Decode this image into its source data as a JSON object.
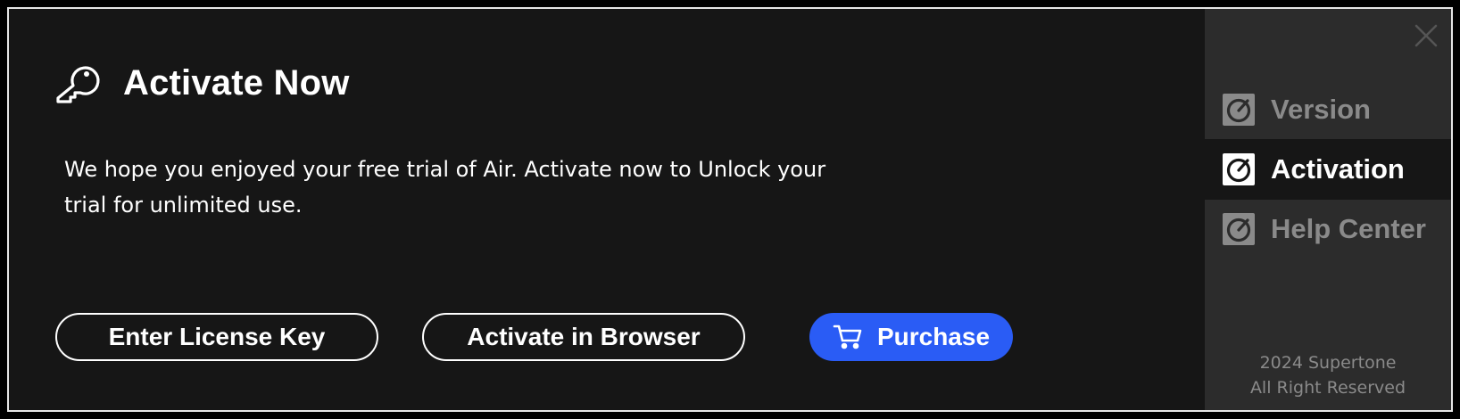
{
  "dialog": {
    "title": "Activate Now",
    "description": "We hope you enjoyed your free trial of Air. Activate now to Unlock your trial for unlimited use.",
    "buttons": {
      "license_label": "Enter License Key",
      "browser_label": "Activate in Browser",
      "purchase_label": "Purchase"
    },
    "icons": {
      "title": "key-icon",
      "purchase": "cart-icon"
    }
  },
  "sidebar": {
    "items": [
      {
        "label": "Version",
        "icon": "dial-icon",
        "active": false
      },
      {
        "label": "Activation",
        "icon": "dial-icon",
        "active": true
      },
      {
        "label": "Help Center",
        "icon": "dial-icon",
        "active": false
      }
    ],
    "footer": {
      "line1": "2024 Supertone",
      "line2": "All Right Reserved"
    }
  },
  "colors": {
    "background": "#161616",
    "sidebar": "#2c2c2c",
    "accent": "#2a5cf5",
    "muted_text": "#8a8a8a",
    "border": "#e6e6e6"
  }
}
